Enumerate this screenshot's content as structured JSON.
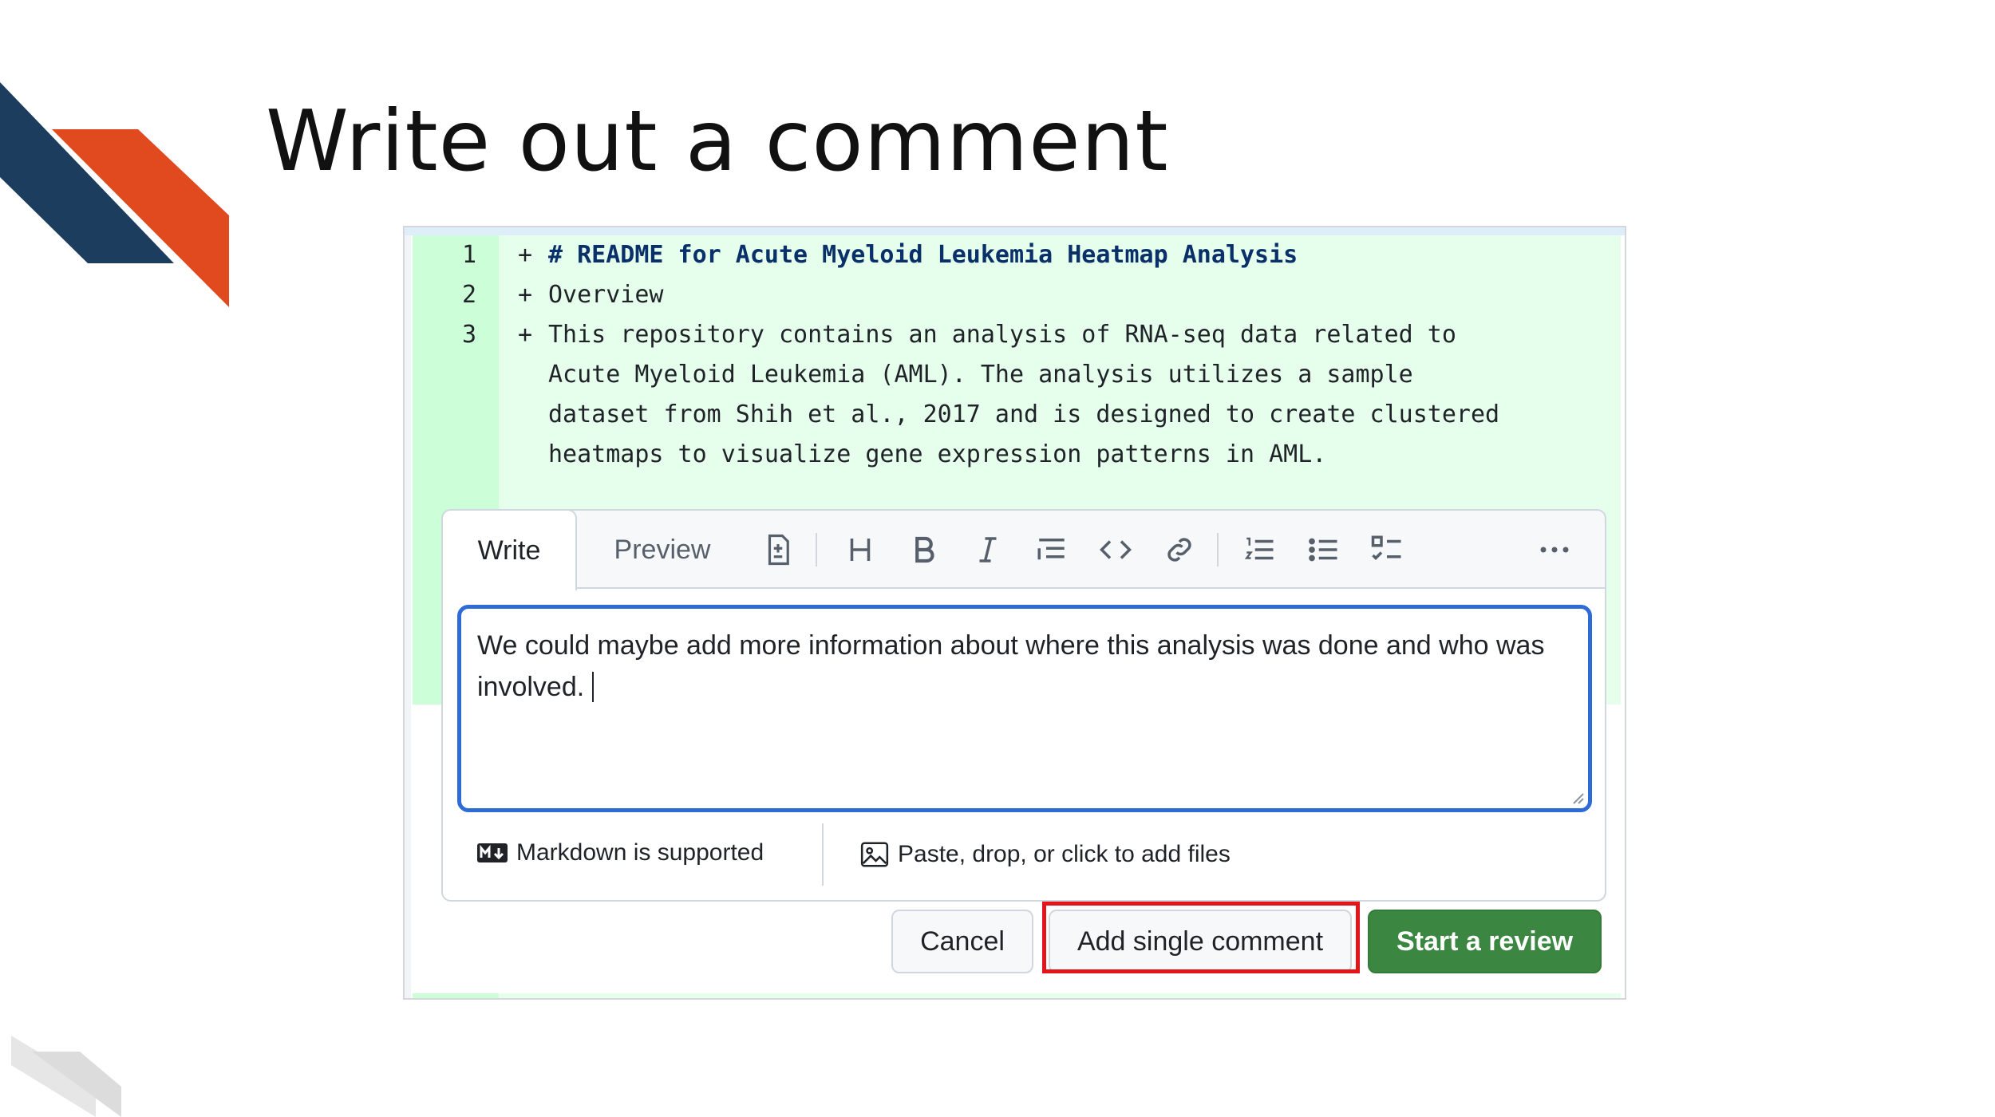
{
  "slide": {
    "title": "Write out a comment"
  },
  "diff": {
    "lines": [
      {
        "number": "1",
        "marker": "+",
        "text": "# README for Acute Myeloid Leukemia Heatmap Analysis"
      },
      {
        "number": "2",
        "marker": "+",
        "text": "Overview"
      },
      {
        "number": "3",
        "marker": "+",
        "text": "This repository contains an analysis of RNA-seq data related to"
      }
    ],
    "continuation": [
      "Acute Myeloid Leukemia (AML). The analysis utilizes a sample",
      "dataset from Shih et al., 2017 and is designed to create clustered",
      "heatmaps to visualize gene expression patterns in AML."
    ]
  },
  "comment": {
    "tabs": {
      "write": "Write",
      "preview": "Preview"
    },
    "toolbar_icons": [
      "file-diff-icon",
      "heading-icon",
      "bold-icon",
      "italic-icon",
      "quote-icon",
      "code-icon",
      "link-icon",
      "ordered-list-icon",
      "unordered-list-icon",
      "task-list-icon",
      "more-options-icon"
    ],
    "text": "We could maybe add more information about where this analysis was done and who was involved.",
    "markdown_hint": "Markdown is supported",
    "attach_hint": "Paste, drop, or click to add files"
  },
  "buttons": {
    "cancel": "Cancel",
    "single": "Add single comment",
    "review": "Start a review"
  },
  "colors": {
    "diff_added_bg": "#e6ffec",
    "gutter_added_bg": "#ccffd8",
    "focus_border": "#2f6bd6",
    "primary_button": "#3b8741",
    "highlight": "#e3151a",
    "deco_navy": "#1c3d5e",
    "deco_orange": "#e14a1e"
  }
}
